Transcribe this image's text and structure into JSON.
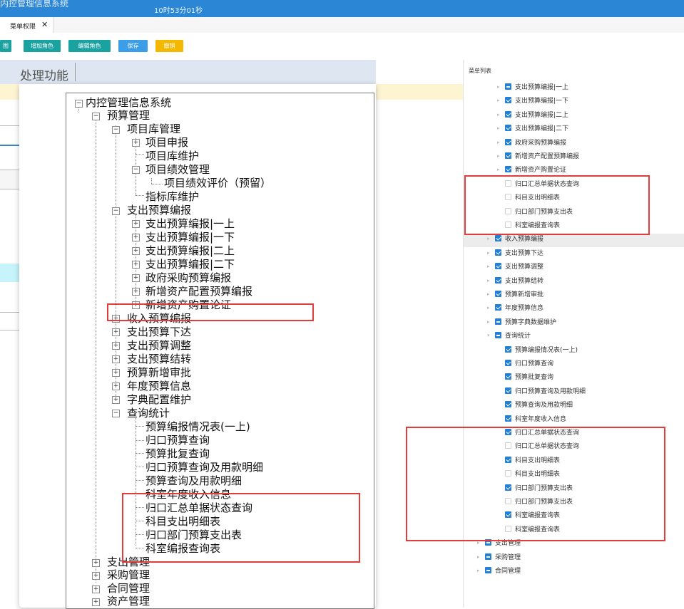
{
  "header": {
    "title": "内控管理信息系统",
    "time_text": "10时53分01秒"
  },
  "tabs": [
    {
      "label": "菜单权限",
      "close": "✕"
    }
  ],
  "toolbar": {
    "partial_label": "图",
    "add_role": "增加角色",
    "edit_role": "编辑角色",
    "save": "保存",
    "revoke": "撤销",
    "colors": {
      "green": "#1aa2a0",
      "blue": "#3d9ee8",
      "orange": "#f5b800"
    }
  },
  "panel_header": {
    "label": "处理功能"
  },
  "tree": {
    "root": "内控管理信息系统",
    "budget_mgmt": "预算管理",
    "project_lib_mgmt": "项目库管理",
    "project_report": "项目申报",
    "project_lib_maint": "项目库维护",
    "project_perf_mgmt": "项目绩效管理",
    "project_perf_eval": "项目绩效评价（预留）",
    "indicator_lib_maint": "指标库维护",
    "expense_budget_compile": "支出预算编报",
    "compile_1_up": "支出预算编报|一上",
    "compile_1_down": "支出预算编报|一下",
    "compile_2_up": "支出预算编报|二上",
    "compile_2_down": "支出预算编报|二下",
    "gov_purchase_compile": "政府采购预算编报",
    "new_asset_config": "新增资产配置预算编报",
    "new_asset_purchase_demo": "新增资产购置论证",
    "income_budget_compile": "收入预算编报",
    "expense_budget_issue": "支出预算下达",
    "expense_budget_adjust": "支出预算调整",
    "expense_budget_carry": "支出预算结转",
    "budget_new_approval": "预算新增审批",
    "annual_budget_info": "年度预算信息",
    "dict_config_maint": "字典配置维护",
    "query_stats": "查询统计",
    "q_compile_status": "预算编报情况表(一上)",
    "q_central_budget": "归口预算查询",
    "q_budget_approval": "预算批复查询",
    "q_central_budget_detail": "归口预算查询及用款明细",
    "q_budget_detail": "预算查询及用款明细",
    "q_office_income": "科室年度收入信息",
    "q_central_summary_status": "归口汇总单据状态查询",
    "q_subject_expense": "科目支出明细表",
    "q_central_dept_expense": "归口部门预算支出表",
    "q_office_compile": "科室编报查询表",
    "expense_mgmt": "支出管理",
    "purchase_mgmt": "采购管理",
    "contract_mgmt": "合同管理",
    "asset_mgmt": "资产管理",
    "expander_plus": "+",
    "expander_minus": "−"
  },
  "right_panel": {
    "title": "菜单列表",
    "items": [
      {
        "label": "支出预算编报|一上",
        "state": "partial",
        "arrow": "▸"
      },
      {
        "label": "支出预算编报|一下",
        "state": "checked",
        "arrow": "▸"
      },
      {
        "label": "支出预算编报|二上",
        "state": "checked",
        "arrow": "▸"
      },
      {
        "label": "支出预算编报|二下",
        "state": "checked",
        "arrow": "▸"
      },
      {
        "label": "政府采购预算编报",
        "state": "checked",
        "arrow": "▸"
      },
      {
        "label": "新增资产配置预算编报",
        "state": "checked",
        "arrow": "▸"
      },
      {
        "label": "新增资产购置论证",
        "state": "checked",
        "arrow": "▸"
      },
      {
        "label": "归口汇总单据状态查询",
        "state": "empty",
        "arrow": ""
      },
      {
        "label": "科目支出明细表",
        "state": "empty",
        "arrow": ""
      },
      {
        "label": "归口部门预算支出表",
        "state": "empty",
        "arrow": ""
      },
      {
        "label": "科室编报查询表",
        "state": "empty",
        "arrow": ""
      },
      {
        "label": "收入预算编报",
        "state": "checked",
        "arrow": "▸"
      },
      {
        "label": "支出预算下达",
        "state": "checked",
        "arrow": "▸"
      },
      {
        "label": "支出预算调整",
        "state": "checked",
        "arrow": "▸"
      },
      {
        "label": "支出预算结转",
        "state": "checked",
        "arrow": "▸"
      },
      {
        "label": "预算新增审批",
        "state": "checked",
        "arrow": "▸"
      },
      {
        "label": "年度预算信息",
        "state": "checked",
        "arrow": "▸"
      },
      {
        "label": "预算字典数据维护",
        "state": "partial",
        "arrow": "▸"
      },
      {
        "label": "查询统计",
        "state": "partial",
        "arrow": "▾"
      },
      {
        "label": "预算编报情况表(一上)",
        "state": "checked",
        "arrow": ""
      },
      {
        "label": "归口预算查询",
        "state": "checked",
        "arrow": ""
      },
      {
        "label": "预算批复查询",
        "state": "checked",
        "arrow": ""
      },
      {
        "label": "归口预算查询及用款明细",
        "state": "checked",
        "arrow": ""
      },
      {
        "label": "预算查询及用款明细",
        "state": "checked",
        "arrow": ""
      },
      {
        "label": "科室年度收入信息",
        "state": "checked",
        "arrow": ""
      },
      {
        "label": "归口汇总单据状态查询",
        "state": "checked",
        "arrow": ""
      },
      {
        "label": "归口汇总单据状态查询",
        "state": "empty",
        "arrow": ""
      },
      {
        "label": "科目支出明细表",
        "state": "checked",
        "arrow": ""
      },
      {
        "label": "科目支出明细表",
        "state": "empty",
        "arrow": ""
      },
      {
        "label": "归口部门预算支出表",
        "state": "checked",
        "arrow": ""
      },
      {
        "label": "归口部门预算支出表",
        "state": "empty",
        "arrow": ""
      },
      {
        "label": "科室编报查询表",
        "state": "checked",
        "arrow": ""
      },
      {
        "label": "科室编报查询表",
        "state": "empty",
        "arrow": ""
      },
      {
        "label": "支出管理",
        "state": "partial",
        "arrow": "▸"
      },
      {
        "label": "采购管理",
        "state": "partial",
        "arrow": "▸"
      },
      {
        "label": "合同管理",
        "state": "partial",
        "arrow": "▸"
      }
    ]
  }
}
